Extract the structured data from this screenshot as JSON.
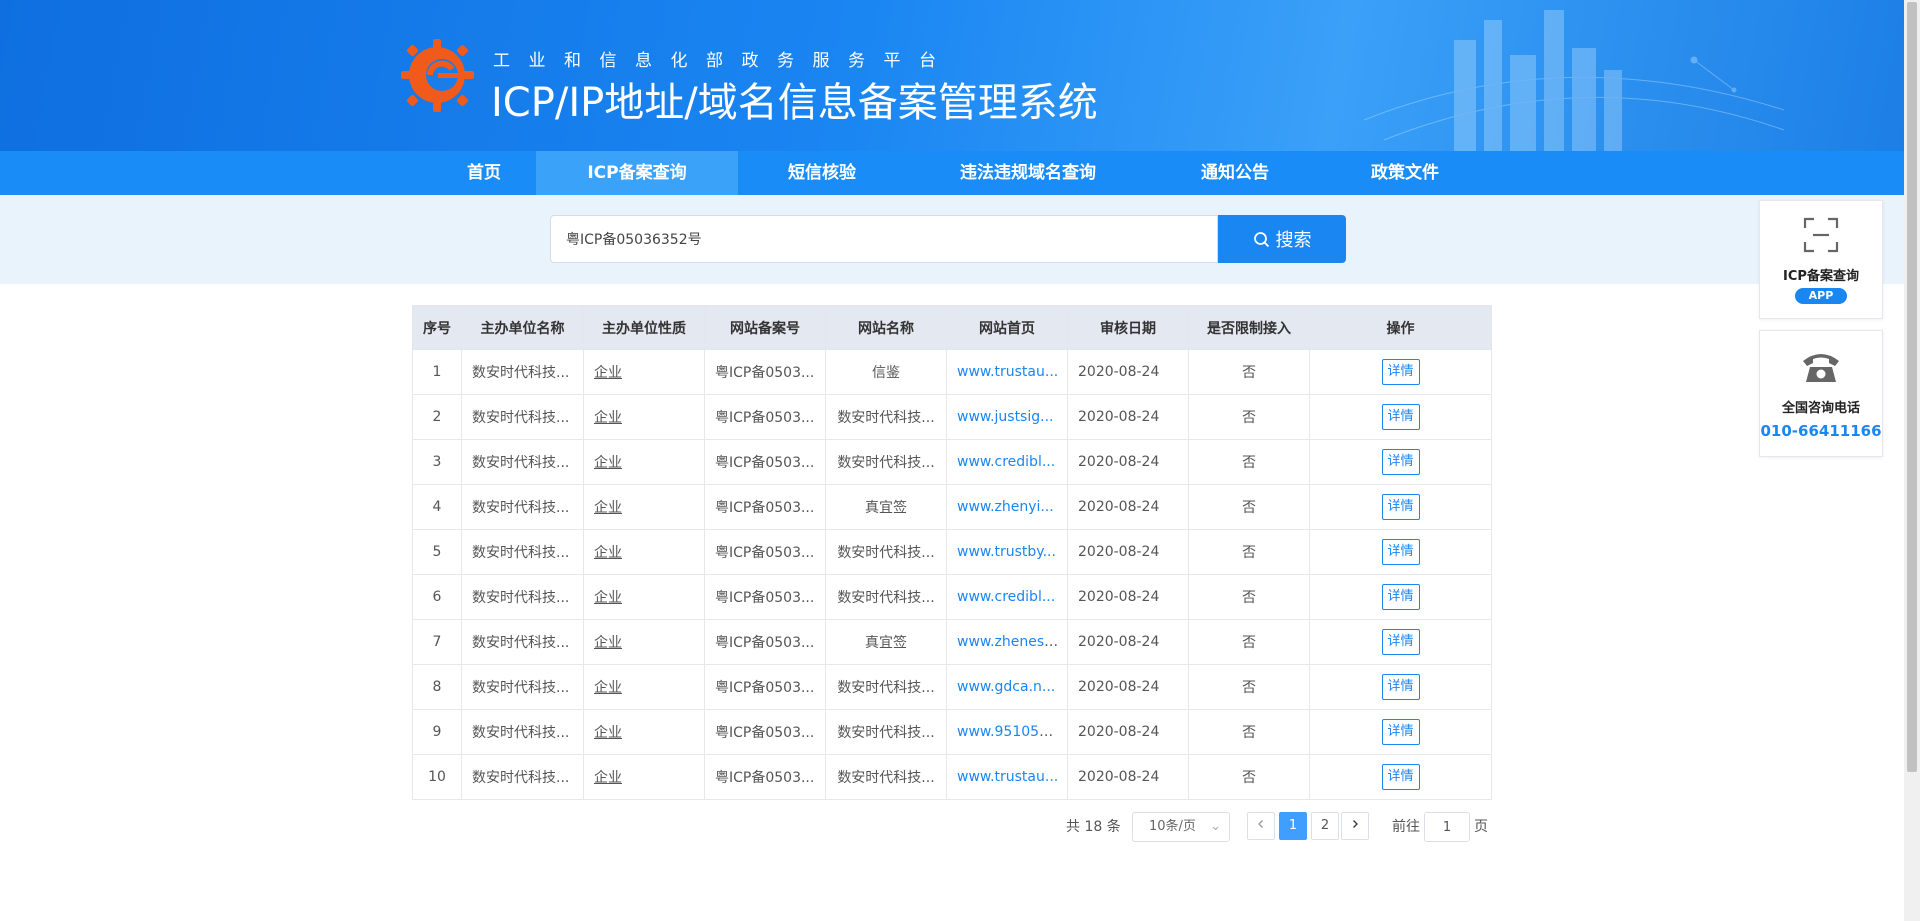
{
  "header": {
    "subtitle": "工业和信息化部政务服务平台",
    "title": "ICP/IP地址/域名信息备案管理系统"
  },
  "nav": {
    "items": [
      {
        "label": "首页",
        "active": false
      },
      {
        "label": "ICP备案查询",
        "active": true
      },
      {
        "label": "短信核验",
        "active": false
      },
      {
        "label": "违法违规域名查询",
        "active": false
      },
      {
        "label": "通知公告",
        "active": false
      },
      {
        "label": "政策文件",
        "active": false
      }
    ]
  },
  "search": {
    "value": "粤ICP备05036352号",
    "button_label": "搜索"
  },
  "table": {
    "headers": [
      "序号",
      "主办单位名称",
      "主办单位性质",
      "网站备案号",
      "网站名称",
      "网站首页",
      "审核日期",
      "是否限制接入",
      "操作"
    ],
    "rows": [
      {
        "no": "1",
        "org": "数安时代科技...",
        "nature": "企业",
        "icp": "粤ICP备0503...",
        "site": "信鉴",
        "home": "www.trustau...",
        "date": "2020-08-24",
        "limit": "否",
        "action": "详情"
      },
      {
        "no": "2",
        "org": "数安时代科技...",
        "nature": "企业",
        "icp": "粤ICP备0503...",
        "site": "数安时代科技...",
        "home": "www.justsig...",
        "date": "2020-08-24",
        "limit": "否",
        "action": "详情"
      },
      {
        "no": "3",
        "org": "数安时代科技...",
        "nature": "企业",
        "icp": "粤ICP备0503...",
        "site": "数安时代科技...",
        "home": "www.credibl...",
        "date": "2020-08-24",
        "limit": "否",
        "action": "详情"
      },
      {
        "no": "4",
        "org": "数安时代科技...",
        "nature": "企业",
        "icp": "粤ICP备0503...",
        "site": "真宜签",
        "home": "www.zhenyi...",
        "date": "2020-08-24",
        "limit": "否",
        "action": "详情"
      },
      {
        "no": "5",
        "org": "数安时代科技...",
        "nature": "企业",
        "icp": "粤ICP备0503...",
        "site": "数安时代科技...",
        "home": "www.trustby...",
        "date": "2020-08-24",
        "limit": "否",
        "action": "详情"
      },
      {
        "no": "6",
        "org": "数安时代科技...",
        "nature": "企业",
        "icp": "粤ICP备0503...",
        "site": "数安时代科技...",
        "home": "www.credibl...",
        "date": "2020-08-24",
        "limit": "否",
        "action": "详情"
      },
      {
        "no": "7",
        "org": "数安时代科技...",
        "nature": "企业",
        "icp": "粤ICP备0503...",
        "site": "真宜签",
        "home": "www.zhenesi...",
        "date": "2020-08-24",
        "limit": "否",
        "action": "详情"
      },
      {
        "no": "8",
        "org": "数安时代科技...",
        "nature": "企业",
        "icp": "粤ICP备0503...",
        "site": "数安时代科技...",
        "home": "www.gdca.n...",
        "date": "2020-08-24",
        "limit": "否",
        "action": "详情"
      },
      {
        "no": "9",
        "org": "数安时代科技...",
        "nature": "企业",
        "icp": "粤ICP备0503...",
        "site": "数安时代科技...",
        "home": "www.951058...",
        "date": "2020-08-24",
        "limit": "否",
        "action": "详情"
      },
      {
        "no": "10",
        "org": "数安时代科技...",
        "nature": "企业",
        "icp": "粤ICP备0503...",
        "site": "数安时代科技...",
        "home": "www.trustau...",
        "date": "2020-08-24",
        "limit": "否",
        "action": "详情"
      }
    ]
  },
  "pagination": {
    "total_text": "共 18 条",
    "page_size": "10条/页",
    "prev_icon": "chevron-left-icon",
    "pages": [
      "1",
      "2"
    ],
    "current_page": "1",
    "next_icon": "chevron-right-icon",
    "goto_label": "前往",
    "goto_value": "1",
    "goto_unit": "页"
  },
  "side_panel": {
    "app_card": {
      "icon": "scan-icon",
      "label": "ICP备案查询",
      "badge": "APP"
    },
    "phone_card": {
      "icon": "telephone-icon",
      "label": "全国咨询电话",
      "number": "010-66411166"
    }
  },
  "colors": {
    "brand_blue": "#1a86f2",
    "nav_bg": "#1a8cf7",
    "nav_active": "#3aa2f9",
    "search_band": "#e9f3fc",
    "table_header": "#e3e8f1",
    "logo_orange": "#f05a1a"
  }
}
